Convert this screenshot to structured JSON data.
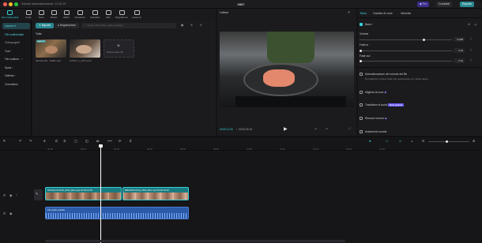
{
  "window": {
    "status": "Salvato automaticamente: 11:02:19",
    "title": "0907",
    "pro_label": "Pro",
    "share_label": "Condividi",
    "export_label": "Esporta"
  },
  "toolbar": {
    "items": [
      {
        "label": "Dati multimediali",
        "icon": "media-icon"
      },
      {
        "label": "Audio",
        "icon": "audio-icon"
      },
      {
        "label": "Testo",
        "icon": "text-icon"
      },
      {
        "label": "Sticker",
        "icon": "sticker-icon"
      },
      {
        "label": "Effetti",
        "icon": "effects-icon"
      },
      {
        "label": "Transizioni",
        "icon": "transitions-icon"
      },
      {
        "label": "Sottotitoli",
        "icon": "subtitles-icon"
      },
      {
        "label": "Filtri",
        "icon": "filters-icon"
      },
      {
        "label": "Regolazione",
        "icon": "adjust-icon"
      },
      {
        "label": "Avatar AI",
        "icon": "avatar-icon"
      }
    ]
  },
  "sidebar": {
    "items": [
      {
        "label": "Importa",
        "active": true
      },
      {
        "label": "File multimediali",
        "sub": true
      },
      {
        "label": "Sottoprogetti",
        "sub": true
      },
      {
        "label": "Tuoi",
        "sub": false
      },
      {
        "label": "File multime...",
        "sub": false
      },
      {
        "label": "Spazi",
        "sub": false
      },
      {
        "label": "Galleria",
        "sub": false
      },
      {
        "label": "Cinematica",
        "sub": false
      }
    ]
  },
  "media": {
    "import_label": "Importa",
    "record_label": "Registrazione",
    "search_placeholder": "Cerca nomi di file, colori e design",
    "section_label": "Tutto",
    "items": [
      {
        "label": "NDC94-FR-...B4b5.mp4",
        "badge": "Aggiunto"
      },
      {
        "label": "1VG5Y_L_JI7C.mp4",
        "badge": ""
      }
    ],
    "stock_label": "Mostra stock HD"
  },
  "player": {
    "title": "Lettore",
    "time_current": "00:00:11:06",
    "time_total": "00:00:29:15"
  },
  "panel": {
    "tabs": [
      "Base",
      "Cambio di voce",
      "Velocità"
    ],
    "section": "Base",
    "volume_label": "Volume",
    "volume_value": "0.0dB",
    "fade_in_label": "Dissolvenza in entrata",
    "fade_in_label_short": "Fade in",
    "fade_in_value": "0.0s",
    "fade_out_label_short": "Fade out",
    "fade_out_value": "0.0s",
    "normalize_label": "Normalizzazione del volume del file",
    "normalize_desc": "Normalizza il volume delle clip selezionate a un livello target.",
    "enhance_label": "Migliora la voce",
    "translate_label": "Traduttore di audio",
    "translate_badge": "Beta gratuita",
    "noise_label": "Rimuovi rumore",
    "isolate_label": "Isolamento vocale"
  },
  "timeline": {
    "ticks": [
      "00:00",
      "00:10",
      "00:20",
      "00:30",
      "00:40",
      "00:50",
      "01:00",
      "01:10",
      "01:20",
      "01:30",
      "01:40"
    ],
    "clips": [
      {
        "title": "NDC94-FR-PGD_0540_Bba.mp4  00:00:15:00"
      },
      {
        "title": "BMZ94FR-PGD_0540_Bba.mp4  00:00:15:00"
      }
    ],
    "audio_clip": "File audio estratto",
    "cover_label": "Copertina"
  },
  "colors": {
    "accent": "#35d0d8",
    "accent_bg": "#23434a",
    "clip": "#1a7a80",
    "audio": "#2b5aa8",
    "playhead": "#ffffff",
    "pro": "#6b5cff"
  }
}
